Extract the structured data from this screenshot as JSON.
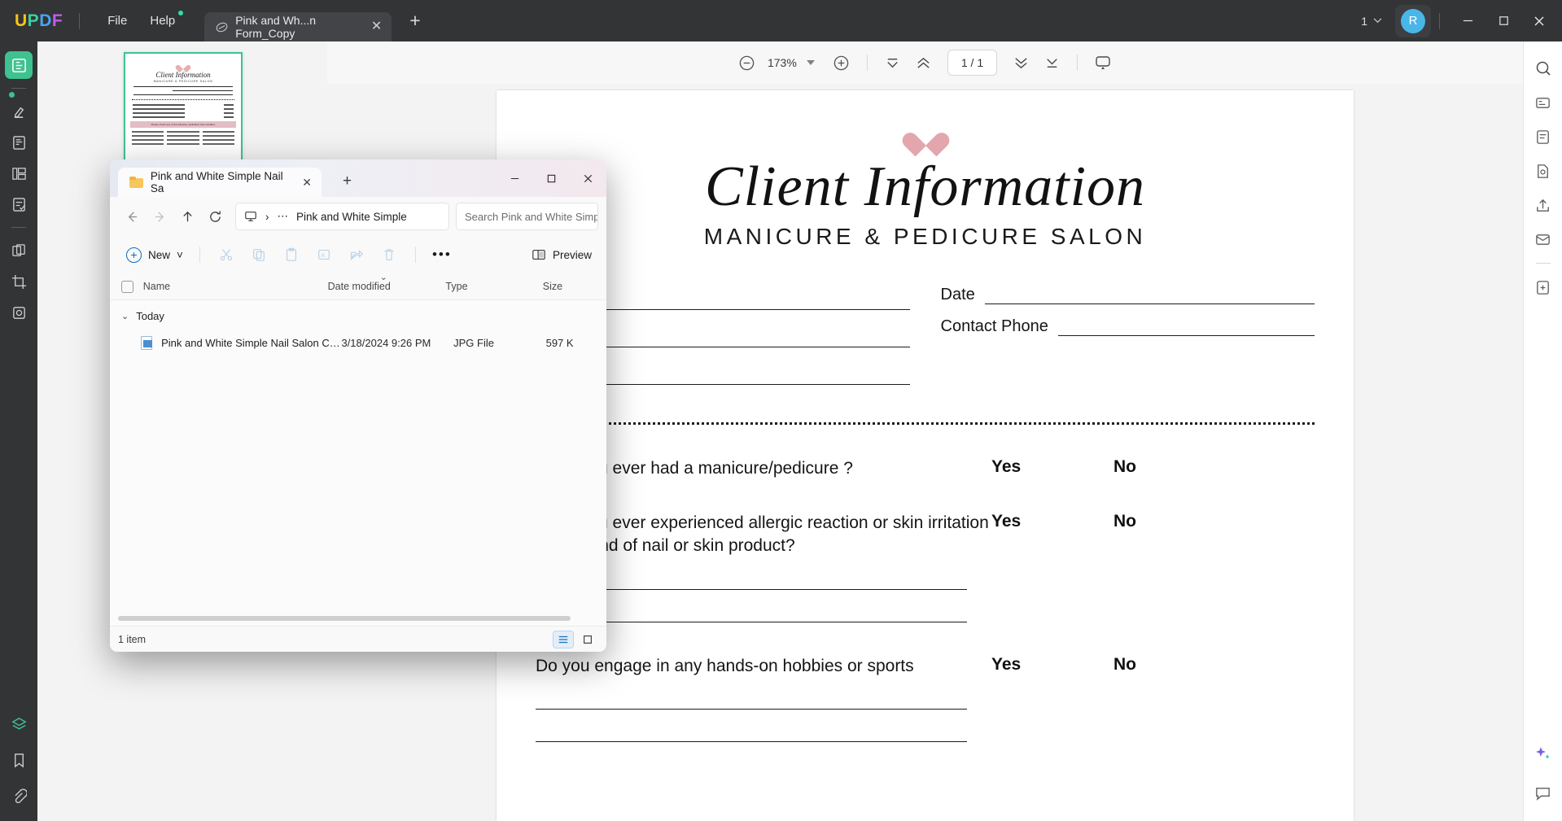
{
  "app": {
    "logo_letters": [
      "U",
      "P",
      "D",
      "F"
    ],
    "menus": [
      {
        "label": "File",
        "has_dot": false
      },
      {
        "label": "Help",
        "has_dot": true
      }
    ],
    "document_tab": {
      "title": "Pink and Wh...n Form_Copy",
      "close_label": "✕",
      "icon": "pdf-doc-icon"
    },
    "new_tab_label": "+",
    "window_page_count": "1",
    "avatar_letter": "R",
    "window_controls": {
      "minimize": "—",
      "maximize": "□",
      "close": "✕"
    }
  },
  "viewer_toolbar": {
    "zoom_out_label": "−",
    "zoom_value": "173%",
    "zoom_in_label": "+",
    "page_indicator": "1 / 1",
    "icons": [
      "zoom-out-icon",
      "zoom-dropdown-icon",
      "zoom-in-icon",
      "first-page-icon",
      "previous-page-icon",
      "next-page-icon",
      "last-page-icon",
      "presentation-mode-icon"
    ]
  },
  "left_rail": {
    "items": [
      {
        "name": "reader-tool",
        "active": true
      },
      {
        "name": "annotate-tool",
        "active": false
      },
      {
        "name": "edit-pdf-tool",
        "active": false
      },
      {
        "name": "organize-pages-tool",
        "active": false
      },
      {
        "name": "form-tool",
        "active": false
      },
      {
        "name": "convert-tool",
        "active": false
      },
      {
        "name": "crop-tool",
        "active": false
      },
      {
        "name": "protect-tool",
        "active": false
      }
    ],
    "bottom_items": [
      "layers-tool",
      "bookmark-tool",
      "attachment-tool"
    ]
  },
  "right_rail": {
    "items": [
      "search-icon",
      "ocr-icon",
      "scan-icon",
      "document-info-icon",
      "share-icon",
      "mail-icon",
      "compress-icon"
    ],
    "bottom_items": [
      "ai-assistant-icon",
      "chat-icon"
    ]
  },
  "document": {
    "heart_icon": "heart-icon",
    "title": "Client Information",
    "subtitle": "MANICURE & PEDICURE SALON",
    "fields": [
      {
        "label": "Date"
      },
      {
        "label": "Contact Phone"
      }
    ],
    "questions": [
      {
        "text": "Have you ever had a manicure/pedicure ?",
        "yes": "Yes",
        "no": "No",
        "has_lines": 0
      },
      {
        "text": "Have you ever experienced allergic reaction or skin irritation to any kind of nail or skin product?",
        "yes": "Yes",
        "no": "No",
        "has_lines": 2
      },
      {
        "text": "Do you engage in any hands-on hobbies or sports",
        "yes": "Yes",
        "no": "No",
        "has_lines": 2
      }
    ]
  },
  "thumbnail": {
    "title": "Client Information",
    "subtitle": "MANICURE & PEDICURE SALON",
    "band_text": "Please check any of the following medication skin condition"
  },
  "explorer": {
    "tab_title": "Pink and White Simple Nail Sa",
    "tab_close": "✕",
    "new_tab": "+",
    "window_controls": {
      "minimize": "—",
      "maximize": "□",
      "close": "✕"
    },
    "nav": {
      "back": "back-icon",
      "forward": "forward-icon",
      "up": "up-icon",
      "refresh": "refresh-icon"
    },
    "breadcrumb": {
      "device_icon": "this-pc-icon",
      "separator": "›",
      "overflow": "⋯",
      "current": "Pink and White Simple"
    },
    "search_placeholder": "Search Pink and White Simple Nai",
    "commands": {
      "new_label": "New",
      "new_caret": "˅",
      "cut": "cut-icon",
      "copy": "copy-icon",
      "paste": "paste-icon",
      "rename": "rename-icon",
      "share": "share-icon",
      "delete": "delete-icon",
      "more": "•••",
      "preview_label": "Preview"
    },
    "columns": [
      "Name",
      "Date modified",
      "Type",
      "Size"
    ],
    "group_label": "Today",
    "group_caret": "⌄",
    "files": [
      {
        "name": "Pink and White Simple Nail Salon Clie...",
        "date": "3/18/2024 9:26 PM",
        "type": "JPG File",
        "size": "597 K"
      }
    ],
    "status": "1 item",
    "view_buttons": [
      "details-view-icon",
      "large-icons-view-icon"
    ]
  },
  "colors": {
    "accent_green": "#3ec28f",
    "accent_blue": "#49b6e8",
    "titlebar_bg": "#333436",
    "heart_pink": "#e3a6ad",
    "band_pink": "#e3bcc6"
  }
}
